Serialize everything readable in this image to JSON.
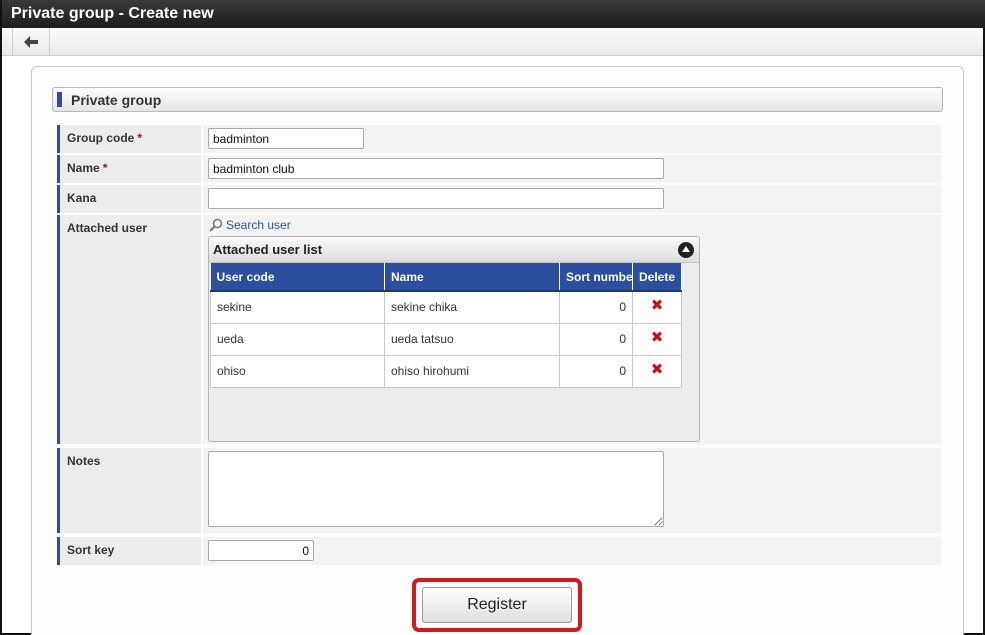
{
  "window": {
    "title": "Private group - Create new"
  },
  "section": {
    "title": "Private group"
  },
  "fields": {
    "group_code": {
      "label": "Group code",
      "required_mark": "*",
      "value": "badminton"
    },
    "name": {
      "label": "Name",
      "required_mark": "*",
      "value": "badminton club"
    },
    "kana": {
      "label": "Kana",
      "value": ""
    },
    "attached_user": {
      "label": "Attached user",
      "search_link": "Search user"
    },
    "notes": {
      "label": "Notes",
      "value": ""
    },
    "sort_key": {
      "label": "Sort key",
      "value": "0"
    }
  },
  "user_list": {
    "title": "Attached user list",
    "columns": [
      "User code",
      "Name",
      "Sort number",
      "Delete"
    ],
    "rows": [
      {
        "code": "sekine",
        "name": "sekine chika",
        "sort": "0"
      },
      {
        "code": "ueda",
        "name": "ueda tatsuo",
        "sort": "0"
      },
      {
        "code": "ohiso",
        "name": "ohiso hirohumi",
        "sort": "0"
      }
    ]
  },
  "actions": {
    "register_label": "Register"
  },
  "colors": {
    "accent": "#2b4f9e",
    "highlight": "#d11a1a",
    "delete": "#cc1111"
  },
  "icons": {
    "back": "arrow-left-icon",
    "search": "magnifier-icon",
    "collapse": "chevron-up-icon",
    "delete": "x-icon"
  }
}
